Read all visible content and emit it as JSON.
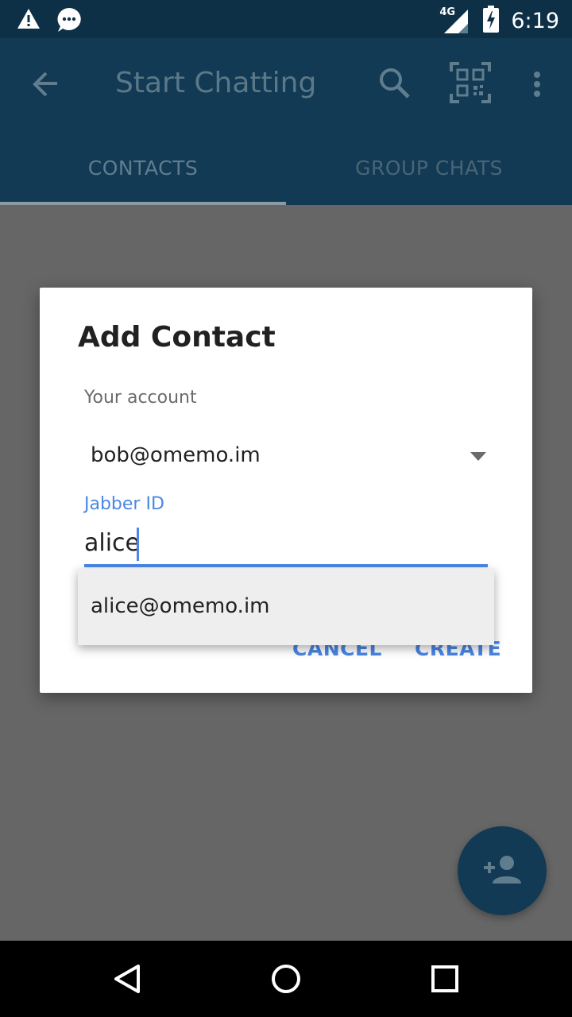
{
  "status_bar": {
    "clock": "6:19",
    "network_label": "4G",
    "icons": [
      "warning-icon",
      "chat-notification-icon",
      "signal-icon",
      "battery-charging-icon"
    ]
  },
  "toolbar": {
    "title": "Start Chatting",
    "icons": [
      "back-arrow-icon",
      "search-icon",
      "qr-code-icon",
      "more-vert-icon"
    ]
  },
  "tabs": [
    {
      "label": "CONTACTS",
      "selected": true
    },
    {
      "label": "GROUP CHATS",
      "selected": false
    }
  ],
  "dialog": {
    "title": "Add Contact",
    "account_label": "Your account",
    "account_value": "bob@omemo.im",
    "jid_label": "Jabber ID",
    "jid_value": "alice",
    "cancel_label": "CANCEL",
    "create_label": "CREATE"
  },
  "autocomplete": {
    "suggestions": [
      "alice@omemo.im"
    ]
  },
  "fab": {
    "icon": "add-contact-icon"
  },
  "nav_bar": {
    "icons": [
      "back-triangle-icon",
      "home-circle-icon",
      "recents-square-icon"
    ]
  },
  "colors": {
    "primary": "#123a54",
    "status_bar": "#0d3047",
    "accent": "#4a87e6",
    "scrim": "#666666"
  }
}
